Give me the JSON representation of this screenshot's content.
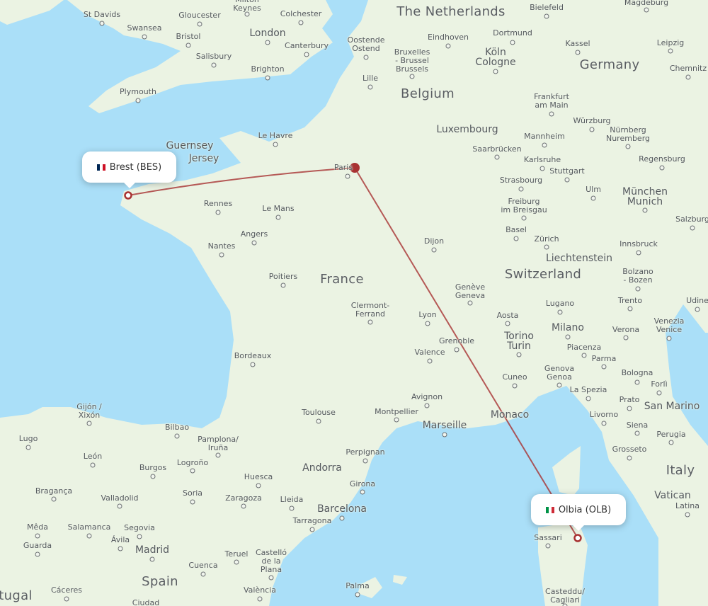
{
  "map": {
    "route_color": "#a83232",
    "land_color": "#ebf3e3",
    "water_color": "#aadff8",
    "origin": {
      "label": "Brest (BES)",
      "city": "Brest",
      "code": "BES",
      "flag_icon": "france-flag-icon",
      "flag_colors": [
        "#002654",
        "#ffffff",
        "#ce1126"
      ]
    },
    "destination": {
      "label": "Olbia (OLB)",
      "city": "Olbia",
      "code": "OLB",
      "flag_icon": "italy-flag-icon",
      "flag_colors": [
        "#009246",
        "#ffffff",
        "#ce2b37"
      ]
    },
    "stopover": {
      "city": "Paris"
    },
    "countries": [
      {
        "id": "netherlands",
        "label": "The Netherlands"
      },
      {
        "id": "belgium",
        "label": "Belgium"
      },
      {
        "id": "luxembourg",
        "label": "Luxembourg"
      },
      {
        "id": "germany",
        "label": "Germany"
      },
      {
        "id": "france",
        "label": "France"
      },
      {
        "id": "switzerland",
        "label": "Switzerland"
      },
      {
        "id": "liechtenstein",
        "label": "Liechtenstein"
      },
      {
        "id": "italy",
        "label": "Italy"
      },
      {
        "id": "spain",
        "label": "Spain"
      },
      {
        "id": "portugal",
        "label": "tugal"
      },
      {
        "id": "andorra",
        "label": "Andorra"
      },
      {
        "id": "monaco",
        "label": "Monaco"
      },
      {
        "id": "san-marino",
        "label": "San Marino"
      },
      {
        "id": "vatican",
        "label": "Vatican"
      },
      {
        "id": "guernsey",
        "label": "Guernsey"
      },
      {
        "id": "jersey",
        "label": "Jersey"
      }
    ],
    "cities": [
      "St Davids",
      "Gloucester",
      "Milton Keynes",
      "Colchester",
      "Swansea",
      "Bristol",
      "London",
      "Canterbury",
      "Salisbury",
      "Brighton",
      "Plymouth",
      "Oostende Ostend",
      "Bruxelles - Brussel Brussels",
      "Lille",
      "Eindhoven",
      "Dortmund",
      "Köln Cologne",
      "Bielefeld",
      "Kassel",
      "Magdeburg",
      "Leipzig",
      "Chemnitz",
      "Frankfurt am Main",
      "Würzburg",
      "Nürnberg Nuremberg",
      "Mannheim",
      "Saarbrücken",
      "Karlsruhe",
      "Stuttgart",
      "Strasbourg",
      "Ulm",
      "München Munich",
      "Regensburg",
      "Freiburg im Breisgau",
      "Basel",
      "Zürich",
      "Salzburg",
      "Innsbruck",
      "Bolzano - Bozen",
      "Trento",
      "Udine",
      "Venezia Venice",
      "Verona",
      "Milano",
      "Lugano",
      "Aosta",
      "Torino Turin",
      "Piacenza",
      "Parma",
      "Bologna",
      "Forlì",
      "Genova Genoa",
      "Cuneo",
      "La Spezia",
      "Prato",
      "Livorno",
      "Siena",
      "Perugia",
      "Grosseto",
      "Latina",
      "Le Havre",
      "Rennes",
      "Le Mans",
      "Angers",
      "Nantes",
      "Poitiers",
      "Bordeaux",
      "Dijon",
      "Genève Geneva",
      "Lyon",
      "Clermont-Ferrand",
      "Grenoble",
      "Valence",
      "Avignon",
      "Montpellier",
      "Marseille",
      "Toulouse",
      "Perpignan",
      "Girona",
      "Barcelona",
      "Tarragona",
      "Lleida",
      "Zaragoza",
      "Huesca",
      "Pamplona/Iruña",
      "Bilbao",
      "Logroño",
      "Burgos",
      "Soria",
      "Gijón / Xixón",
      "Lugo",
      "León",
      "Bragança",
      "Valladolid",
      "Salamanca",
      "Segovia",
      "Ávila",
      "Madrid",
      "Mêda",
      "Guarda",
      "Cáceres",
      "Ciudad",
      "Cuenca",
      "Teruel",
      "Castelló de la Plana",
      "València",
      "Palma",
      "Sassari",
      "Casteddu/Cagliari",
      "Paris"
    ]
  }
}
